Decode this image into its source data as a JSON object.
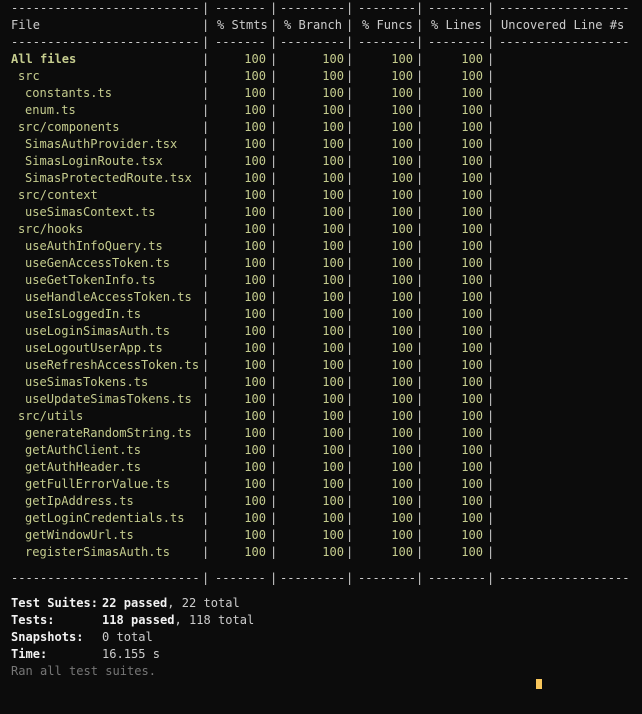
{
  "coverage": {
    "columns": [
      "File",
      "% Stmts",
      "% Branch",
      "% Funcs",
      "% Lines",
      "Uncovered Line #s"
    ],
    "rows": [
      {
        "file": "All files",
        "indent": 0,
        "stmts": "100",
        "branch": "100",
        "funcs": "100",
        "lines": "100",
        "uncovered": ""
      },
      {
        "file": "src",
        "indent": 1,
        "stmts": "100",
        "branch": "100",
        "funcs": "100",
        "lines": "100",
        "uncovered": ""
      },
      {
        "file": "constants.ts",
        "indent": 2,
        "stmts": "100",
        "branch": "100",
        "funcs": "100",
        "lines": "100",
        "uncovered": ""
      },
      {
        "file": "enum.ts",
        "indent": 2,
        "stmts": "100",
        "branch": "100",
        "funcs": "100",
        "lines": "100",
        "uncovered": ""
      },
      {
        "file": "src/components",
        "indent": 1,
        "stmts": "100",
        "branch": "100",
        "funcs": "100",
        "lines": "100",
        "uncovered": ""
      },
      {
        "file": "SimasAuthProvider.tsx",
        "indent": 2,
        "stmts": "100",
        "branch": "100",
        "funcs": "100",
        "lines": "100",
        "uncovered": ""
      },
      {
        "file": "SimasLoginRoute.tsx",
        "indent": 2,
        "stmts": "100",
        "branch": "100",
        "funcs": "100",
        "lines": "100",
        "uncovered": ""
      },
      {
        "file": "SimasProtectedRoute.tsx",
        "indent": 2,
        "stmts": "100",
        "branch": "100",
        "funcs": "100",
        "lines": "100",
        "uncovered": ""
      },
      {
        "file": "src/context",
        "indent": 1,
        "stmts": "100",
        "branch": "100",
        "funcs": "100",
        "lines": "100",
        "uncovered": ""
      },
      {
        "file": "useSimasContext.ts",
        "indent": 2,
        "stmts": "100",
        "branch": "100",
        "funcs": "100",
        "lines": "100",
        "uncovered": ""
      },
      {
        "file": "src/hooks",
        "indent": 1,
        "stmts": "100",
        "branch": "100",
        "funcs": "100",
        "lines": "100",
        "uncovered": ""
      },
      {
        "file": "useAuthInfoQuery.ts",
        "indent": 2,
        "stmts": "100",
        "branch": "100",
        "funcs": "100",
        "lines": "100",
        "uncovered": ""
      },
      {
        "file": "useGenAccessToken.ts",
        "indent": 2,
        "stmts": "100",
        "branch": "100",
        "funcs": "100",
        "lines": "100",
        "uncovered": ""
      },
      {
        "file": "useGetTokenInfo.ts",
        "indent": 2,
        "stmts": "100",
        "branch": "100",
        "funcs": "100",
        "lines": "100",
        "uncovered": ""
      },
      {
        "file": "useHandleAccessToken.ts",
        "indent": 2,
        "stmts": "100",
        "branch": "100",
        "funcs": "100",
        "lines": "100",
        "uncovered": ""
      },
      {
        "file": "useIsLoggedIn.ts",
        "indent": 2,
        "stmts": "100",
        "branch": "100",
        "funcs": "100",
        "lines": "100",
        "uncovered": ""
      },
      {
        "file": "useLoginSimasAuth.ts",
        "indent": 2,
        "stmts": "100",
        "branch": "100",
        "funcs": "100",
        "lines": "100",
        "uncovered": ""
      },
      {
        "file": "useLogoutUserApp.ts",
        "indent": 2,
        "stmts": "100",
        "branch": "100",
        "funcs": "100",
        "lines": "100",
        "uncovered": ""
      },
      {
        "file": "useRefreshAccessToken.ts",
        "indent": 2,
        "stmts": "100",
        "branch": "100",
        "funcs": "100",
        "lines": "100",
        "uncovered": ""
      },
      {
        "file": "useSimasTokens.ts",
        "indent": 2,
        "stmts": "100",
        "branch": "100",
        "funcs": "100",
        "lines": "100",
        "uncovered": ""
      },
      {
        "file": "useUpdateSimasTokens.ts",
        "indent": 2,
        "stmts": "100",
        "branch": "100",
        "funcs": "100",
        "lines": "100",
        "uncovered": ""
      },
      {
        "file": "src/utils",
        "indent": 1,
        "stmts": "100",
        "branch": "100",
        "funcs": "100",
        "lines": "100",
        "uncovered": ""
      },
      {
        "file": "generateRandomString.ts",
        "indent": 2,
        "stmts": "100",
        "branch": "100",
        "funcs": "100",
        "lines": "100",
        "uncovered": ""
      },
      {
        "file": "getAuthClient.ts",
        "indent": 2,
        "stmts": "100",
        "branch": "100",
        "funcs": "100",
        "lines": "100",
        "uncovered": ""
      },
      {
        "file": "getAuthHeader.ts",
        "indent": 2,
        "stmts": "100",
        "branch": "100",
        "funcs": "100",
        "lines": "100",
        "uncovered": ""
      },
      {
        "file": "getFullErrorValue.ts",
        "indent": 2,
        "stmts": "100",
        "branch": "100",
        "funcs": "100",
        "lines": "100",
        "uncovered": ""
      },
      {
        "file": "getIpAddress.ts",
        "indent": 2,
        "stmts": "100",
        "branch": "100",
        "funcs": "100",
        "lines": "100",
        "uncovered": ""
      },
      {
        "file": "getLoginCredentials.ts",
        "indent": 2,
        "stmts": "100",
        "branch": "100",
        "funcs": "100",
        "lines": "100",
        "uncovered": ""
      },
      {
        "file": "getWindowUrl.ts",
        "indent": 2,
        "stmts": "100",
        "branch": "100",
        "funcs": "100",
        "lines": "100",
        "uncovered": ""
      },
      {
        "file": "registerSimasAuth.ts",
        "indent": 2,
        "stmts": "100",
        "branch": "100",
        "funcs": "100",
        "lines": "100",
        "uncovered": ""
      }
    ]
  },
  "summary": {
    "suites_label": "Test Suites:",
    "suites_passed": "22 passed",
    "suites_total": ", 22 total",
    "tests_label": "Tests:",
    "tests_passed": "118 passed",
    "tests_total": ", 118 total",
    "snapshots_label": "Snapshots:",
    "snapshots_value": "0 total",
    "time_label": "Time:",
    "time_value": "16.155 s",
    "ran_all": "Ran all test suites."
  },
  "colors": {
    "background": "#0c0c0c",
    "text": "#cccccc",
    "covered": "#c5cc8e",
    "passed": "#16c60c",
    "dim": "#767676",
    "cursor": "#f9c75c"
  }
}
